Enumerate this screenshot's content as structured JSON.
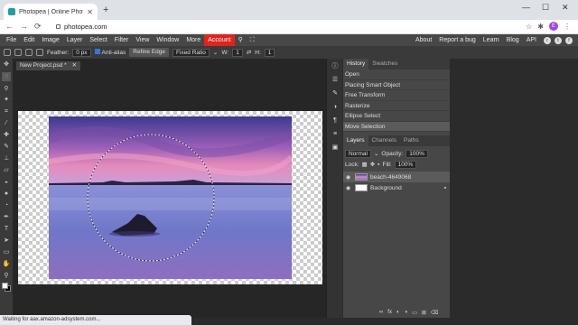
{
  "browser": {
    "tab_title": "Photopea | Online Photo Editor",
    "tab_close": "✕",
    "new_tab": "+",
    "url": "photopea.com",
    "avatar_letter": "E",
    "window_controls": {
      "minimize": "—",
      "maximize": "☐",
      "close": "✕"
    },
    "nav": {
      "back": "←",
      "forward": "→",
      "reload": "⟳"
    },
    "status_text": "Waiting for aax.amazon-adsystem.com..."
  },
  "menu": {
    "items": [
      "File",
      "Edit",
      "Image",
      "Layer",
      "Select",
      "Filter",
      "View",
      "Window",
      "More"
    ],
    "account": "Account",
    "right_items": [
      "About",
      "Report a bug",
      "Learn",
      "Blog",
      "API"
    ]
  },
  "options": {
    "feather_label": "Feather:",
    "feather_value": "0 px",
    "antialias_label": "Anti-alias",
    "refine_edge": "Refine Edge",
    "style_value": "Fixed Ratio",
    "w_label": "W:",
    "w_value": "1",
    "h_label": "H:",
    "h_value": "1"
  },
  "document": {
    "tab_label": "New Project.psd *",
    "tab_close": "✕"
  },
  "history": {
    "tabs": [
      "History",
      "Swatches"
    ],
    "items": [
      "Open",
      "Placing Smart Object",
      "Free Transform",
      "Rasterize",
      "Ellipse Select",
      "Move Selection"
    ]
  },
  "layers": {
    "tabs": [
      "Layers",
      "Channels",
      "Paths"
    ],
    "blend_mode": "Normal",
    "opacity_label": "Opacity:",
    "opacity_value": "100%",
    "lock_label": "Lock:",
    "fill_label": "Fill:",
    "fill_value": "100%",
    "items": [
      {
        "name": "beach-4649068",
        "selected": true
      },
      {
        "name": "Background",
        "selected": false
      }
    ]
  },
  "icons": {
    "tools": [
      "move-icon",
      "marquee-icon",
      "lasso-icon",
      "magic-wand-icon",
      "crop-icon",
      "eyedropper-icon",
      "healing-icon",
      "brush-icon",
      "clone-stamp-icon",
      "eraser-icon",
      "fill-icon",
      "blur-icon",
      "dodge-icon",
      "pen-icon",
      "type-icon",
      "path-select-icon",
      "shape-icon",
      "hand-icon",
      "zoom-icon"
    ]
  },
  "colors": {
    "account": "#e2231a",
    "accent": "#2a7ae2",
    "sky_top": "#3c3a8f",
    "sky_glow": "#e58ab9",
    "water": "#6f77c9"
  }
}
